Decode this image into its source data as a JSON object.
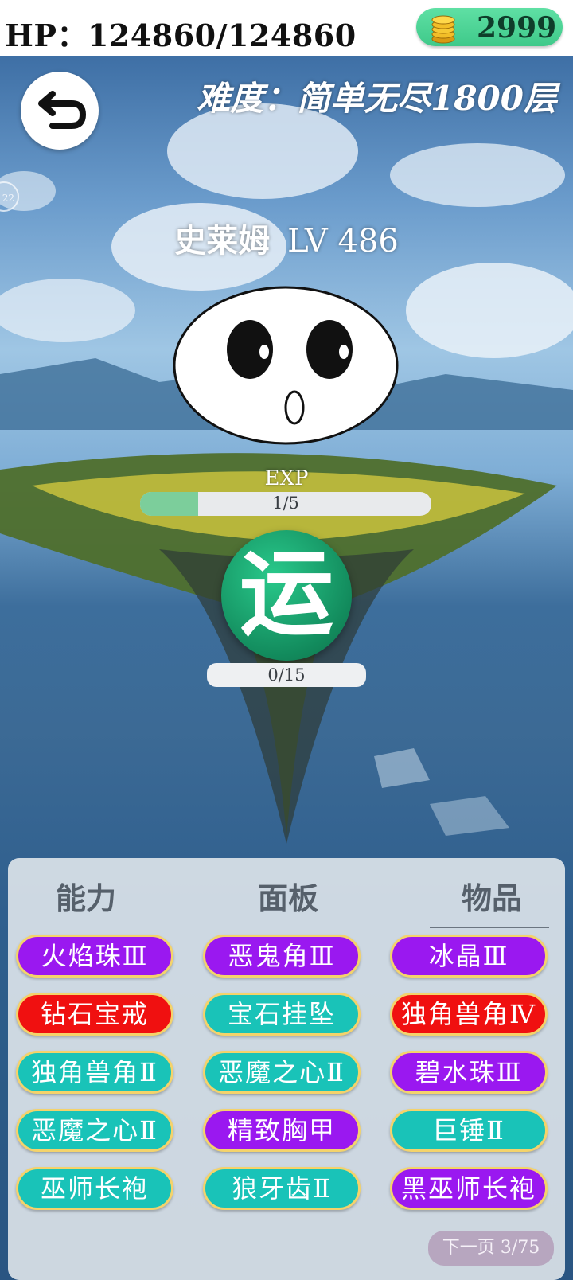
{
  "status": {
    "hp": "HP：124860/124860",
    "gold": "2999"
  },
  "header": {
    "difficulty": "难度：简单无尽1800层",
    "side_tab_number": "22"
  },
  "monster": {
    "name": "史莱姆",
    "level": "LV 486"
  },
  "exp": {
    "label": "EXP",
    "text": "1/5",
    "fraction": 0.2
  },
  "fortune": {
    "button_label": "运",
    "counter": "0/15"
  },
  "panel": {
    "tabs": [
      "能力",
      "面板",
      "物品"
    ],
    "active_tab": "物品",
    "items": [
      {
        "label": "火焰珠Ⅲ",
        "color": "#9a18f0"
      },
      {
        "label": "恶鬼角Ⅲ",
        "color": "#9a18f0"
      },
      {
        "label": "冰晶Ⅲ",
        "color": "#9a18f0"
      },
      {
        "label": "钻石宝戒",
        "color": "#f01010"
      },
      {
        "label": "宝石挂坠",
        "color": "#19c3b8"
      },
      {
        "label": "独角兽角Ⅳ",
        "color": "#f01010"
      },
      {
        "label": "独角兽角Ⅱ",
        "color": "#19c3b8"
      },
      {
        "label": "恶魔之心Ⅱ",
        "color": "#19c3b8"
      },
      {
        "label": "碧水珠Ⅲ",
        "color": "#9a18f0"
      },
      {
        "label": "恶魔之心Ⅱ",
        "color": "#19c3b8"
      },
      {
        "label": "精致胸甲",
        "color": "#9a18f0"
      },
      {
        "label": "巨锤Ⅱ",
        "color": "#19c3b8"
      },
      {
        "label": "巫师长袍",
        "color": "#19c3b8"
      },
      {
        "label": "狼牙齿Ⅱ",
        "color": "#19c3b8"
      },
      {
        "label": "黑巫师长袍",
        "color": "#9a18f0"
      }
    ],
    "next_page": "下一页 3/75"
  },
  "icons": {
    "back": "back-arrow-icon",
    "coin": "gold-coin-icon"
  }
}
